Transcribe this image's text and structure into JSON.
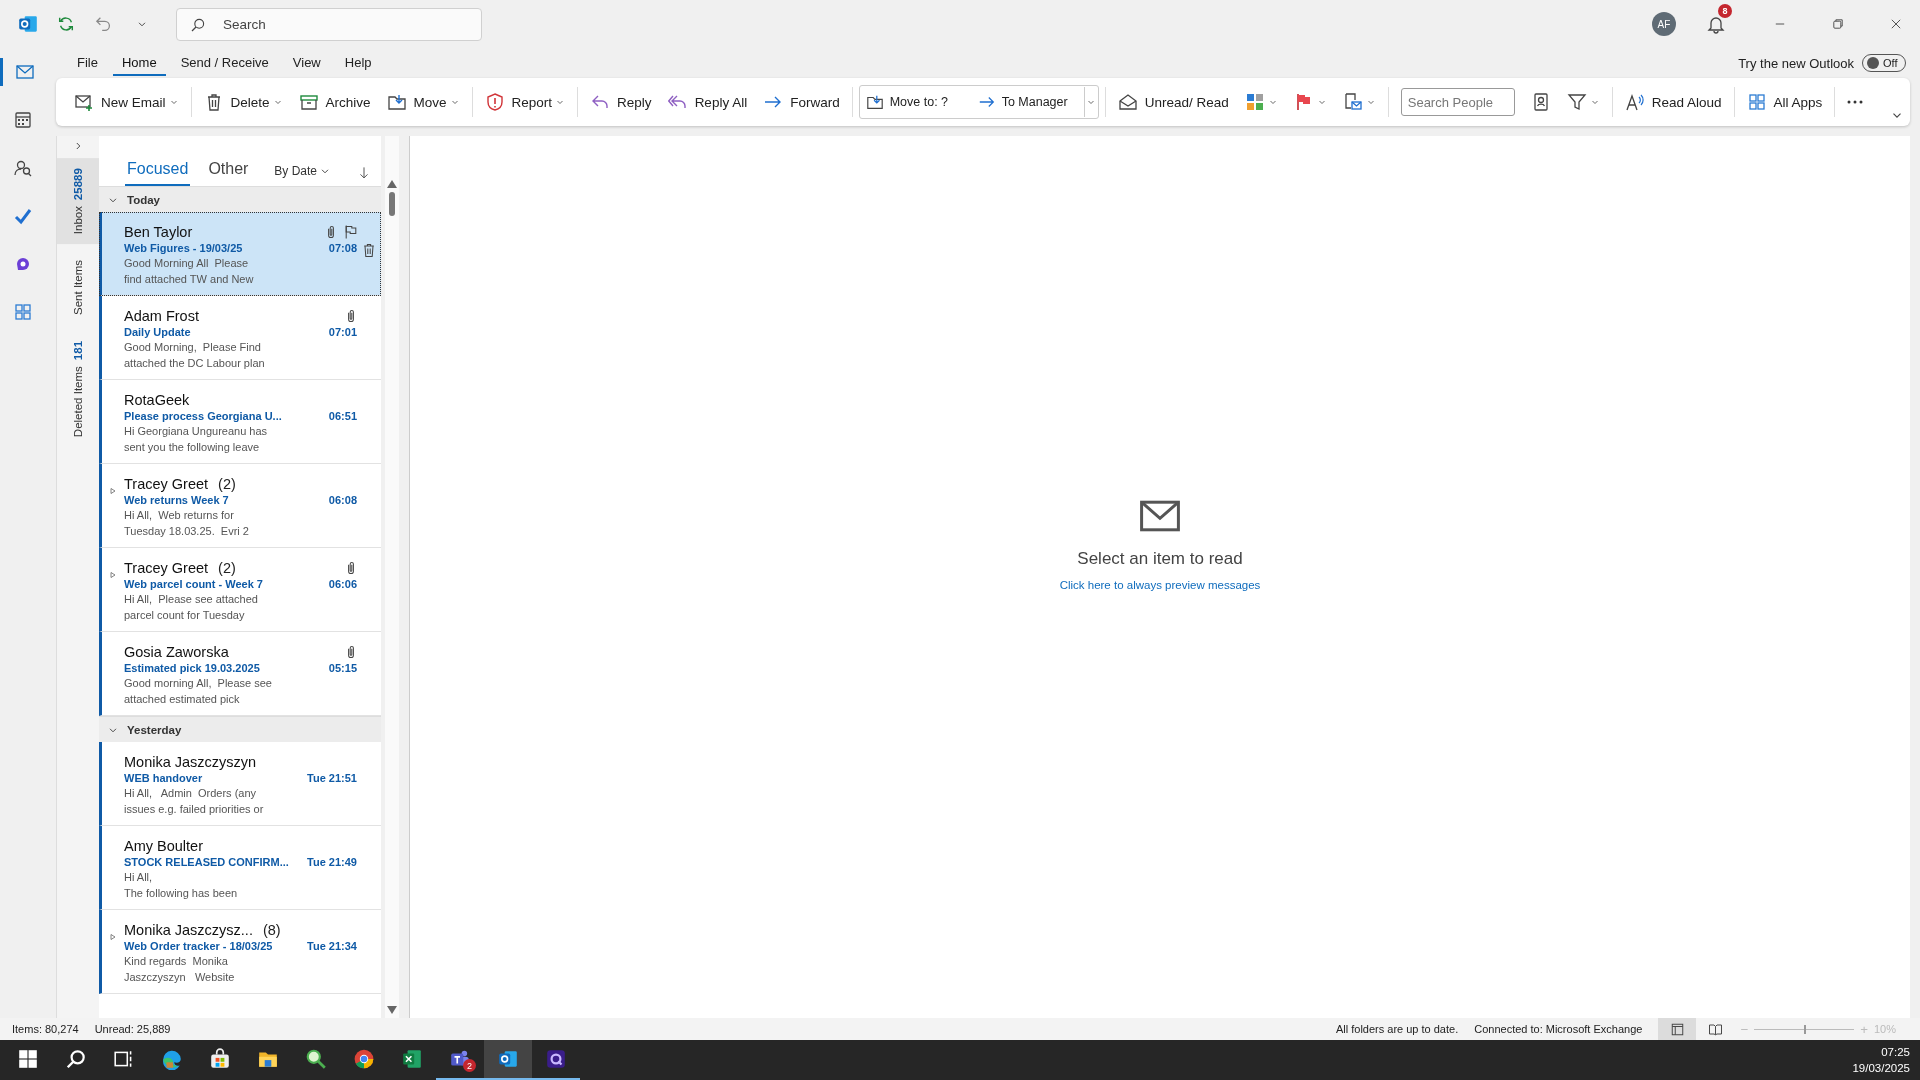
{
  "title_bar": {
    "search_placeholder": "Search",
    "avatar": "AF",
    "notifications": "8"
  },
  "app_rail": [
    {
      "selected": true
    },
    {
      "selected": false
    },
    {
      "selected": false
    },
    {
      "selected": false
    },
    {
      "selected": false
    },
    {
      "selected": false
    }
  ],
  "menu": [
    {
      "label": "File",
      "selected": false
    },
    {
      "label": "Home",
      "selected": true
    },
    {
      "label": "Send / Receive",
      "selected": false
    },
    {
      "label": "View",
      "selected": false
    },
    {
      "label": "Help",
      "selected": false
    }
  ],
  "new_outlook": {
    "label": "Try the new Outlook",
    "toggle": "Off",
    "on": false
  },
  "ribbon": [
    [
      {
        "kind": "button",
        "label": "New Email",
        "caret": true
      }
    ],
    [
      {
        "kind": "button",
        "label": "Delete",
        "caret": true
      },
      {
        "kind": "button",
        "label": "Archive",
        "caret": false
      },
      {
        "kind": "button",
        "label": "Move",
        "caret": true
      }
    ],
    [
      {
        "kind": "button",
        "label": "Report",
        "caret": true
      }
    ],
    [
      {
        "kind": "button",
        "label": "Reply",
        "caret": false
      },
      {
        "kind": "button",
        "label": "Reply All",
        "caret": false
      },
      {
        "kind": "button",
        "label": "Forward",
        "caret": false
      }
    ],
    [
      {
        "kind": "quicksteps",
        "steps": [
          {
            "label": "Move to: ?"
          },
          {
            "label": "To Manager"
          }
        ]
      }
    ],
    [
      {
        "kind": "button",
        "label": "Unread/ Read",
        "caret": false
      },
      {
        "kind": "button",
        "caret": true
      },
      {
        "kind": "button",
        "caret": true
      },
      {
        "kind": "button",
        "caret": true
      }
    ],
    [
      {
        "kind": "search",
        "placeholder": "Search People"
      },
      {
        "kind": "button",
        "caret": false
      },
      {
        "kind": "button",
        "caret": true
      }
    ],
    [
      {
        "kind": "button",
        "label": "Read Aloud",
        "caret": false
      }
    ],
    [
      {
        "kind": "button",
        "label": "All Apps",
        "caret": false
      }
    ],
    [
      {
        "kind": "button",
        "caret": false
      }
    ]
  ],
  "folders": [
    {
      "label": "Inbox",
      "count": "25889",
      "selected": true
    },
    {
      "label": "Sent Items",
      "selected": false
    },
    {
      "label": "Deleted Items",
      "count": "181",
      "selected": false
    }
  ],
  "list": {
    "tabs": [
      {
        "label": "Focused",
        "selected": true
      },
      {
        "label": "Other",
        "selected": false
      }
    ],
    "sort": "By Date",
    "groups": [
      {
        "label": "Today",
        "expanded": true,
        "messages": [
          {
            "sender": "Ben Taylor",
            "subject": "Web Figures - 19/03/25",
            "time": "07:08",
            "preview": [
              "Good Morning All  Please",
              "find attached TW and New"
            ],
            "attachment": true,
            "thread": false,
            "unread": true,
            "selected": true
          },
          {
            "sender": "Adam Frost",
            "subject": "Daily Update",
            "time": "07:01",
            "preview": [
              "Good Morning,  Please Find",
              "attached the DC Labour plan"
            ],
            "attachment": true,
            "thread": false,
            "unread": true,
            "selected": false
          },
          {
            "sender": "RotaGeek",
            "subject": "Please process Georgiana U...",
            "time": "06:51",
            "preview": [
              "Hi Georgiana Ungureanu has",
              "sent you the following leave"
            ],
            "attachment": false,
            "thread": false,
            "unread": true,
            "selected": false
          },
          {
            "sender": "Tracey Greet",
            "count": "(2)",
            "subject": "Web returns Week 7",
            "time": "06:08",
            "preview": [
              "Hi All,  Web returns for",
              "Tuesday 18.03.25.  Evri 2"
            ],
            "attachment": false,
            "thread": true,
            "unread": true,
            "selected": false
          },
          {
            "sender": "Tracey Greet",
            "count": "(2)",
            "subject": "Web parcel count - Week 7",
            "time": "06:06",
            "preview": [
              "Hi All,  Please see attached",
              "parcel count for Tuesday"
            ],
            "attachment": true,
            "thread": true,
            "unread": true,
            "selected": false
          },
          {
            "sender": "Gosia Zaworska",
            "subject": "Estimated pick 19.03.2025",
            "time": "05:15",
            "preview": [
              "Good morning All,  Please see",
              "attached estimated pick"
            ],
            "attachment": true,
            "thread": false,
            "unread": true,
            "selected": false
          }
        ]
      },
      {
        "label": "Yesterday",
        "expanded": true,
        "messages": [
          {
            "sender": "Monika Jaszczyszyn",
            "subject": "WEB handover",
            "time": "Tue 21:51",
            "preview": [
              "Hi All,   Admin  Orders (any",
              "issues e.g. failed priorities or"
            ],
            "attachment": false,
            "thread": false,
            "unread": true,
            "selected": false
          },
          {
            "sender": "Amy Boulter",
            "subject": "STOCK RELEASED CONFIRM...",
            "time": "Tue 21:49",
            "preview": [
              "Hi All,",
              "The following has been"
            ],
            "attachment": false,
            "thread": false,
            "unread": true,
            "selected": false
          },
          {
            "sender": "Monika Jaszczysz...",
            "count": "(8)",
            "subject": "Web Order tracker - 18/03/25",
            "time": "Tue 21:34",
            "preview": [
              "Kind regards  Monika",
              "Jaszczyszyn   Website"
            ],
            "attachment": false,
            "thread": true,
            "unread": true,
            "selected": false
          }
        ]
      }
    ]
  },
  "reading_pane": {
    "title": "Select an item to read",
    "link": "Click here to always preview messages"
  },
  "status_bar": {
    "items": "Items: 80,274",
    "unread": "Unread: 25,889",
    "sync": "All folders are up to date.",
    "connection": "Connected to: Microsoft Exchange",
    "views": [
      {
        "selected": true
      },
      {
        "selected": false
      }
    ],
    "zoom": {
      "minus": "−",
      "plus": "+",
      "level": 0.5,
      "reading": "10%"
    }
  },
  "taskbar": {
    "apps": [
      {
        "running": false,
        "active": false
      },
      {
        "running": false,
        "active": false
      },
      {
        "running": false,
        "active": false
      },
      {
        "running": false,
        "active": false
      },
      {
        "running": false,
        "active": false
      },
      {
        "running": false,
        "active": false
      },
      {
        "running": false,
        "active": false
      },
      {
        "running": false,
        "active": false
      },
      {
        "running": false,
        "active": false
      },
      {
        "badge": "2",
        "running": true,
        "active": false
      },
      {
        "running": true,
        "active": true
      },
      {
        "running": true,
        "active": false
      }
    ],
    "time": "07:25",
    "date": "19/03/2025"
  }
}
